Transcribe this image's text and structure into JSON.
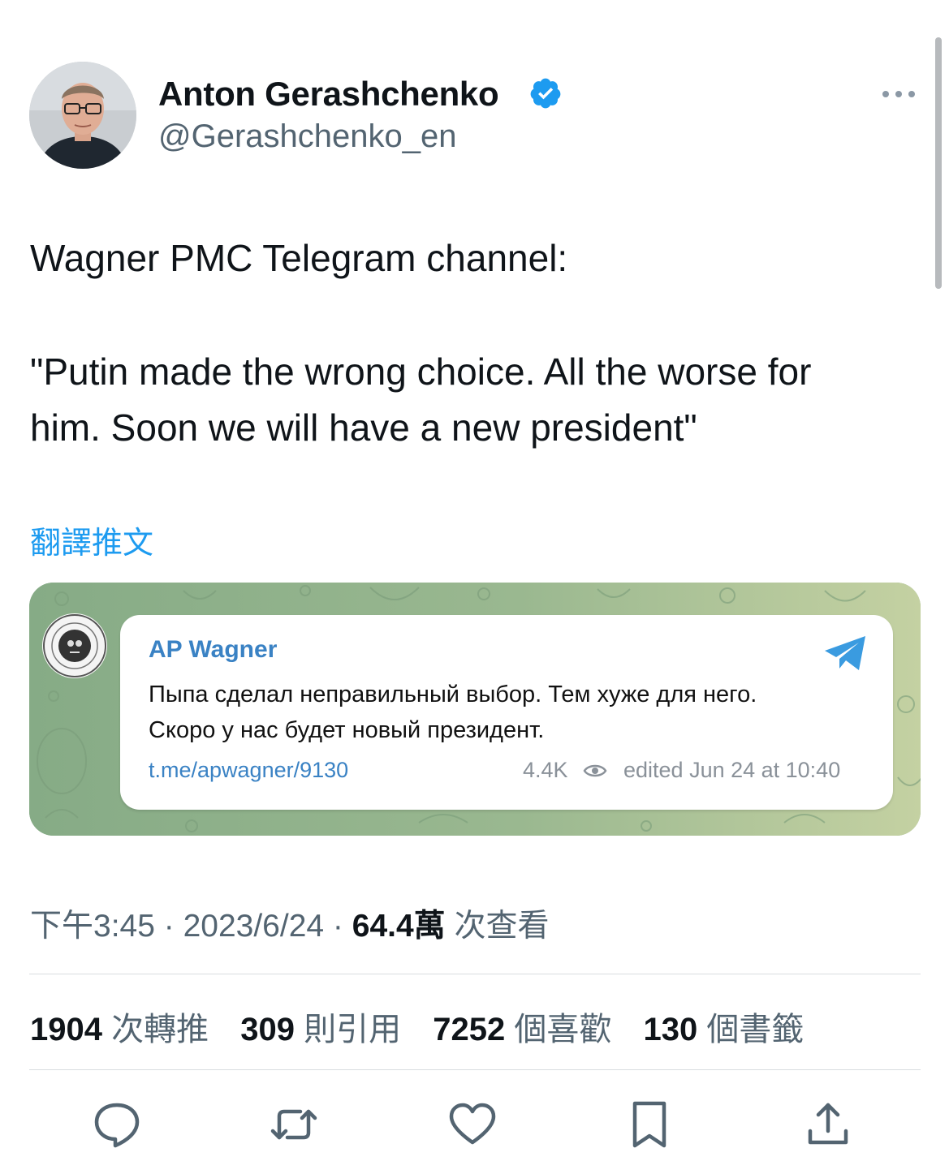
{
  "author": {
    "name": "Anton Gerashchenko",
    "handle": "@Gerashchenko_en",
    "verified_color": "#1d9bf0"
  },
  "tweet": {
    "lines": [
      "Wagner PMC Telegram channel:",
      "\"Putin made the wrong choice. All the worse for",
      "him. Soon we will have a new president\""
    ],
    "translate_label": "翻譯推文"
  },
  "telegram_card": {
    "channel": "AP Wagner",
    "message_lines": [
      "Пыпа сделал неправильный выбор. Тем хуже для него.",
      "Скоро у нас будет новый президент."
    ],
    "link": "t.me/apwagner/9130",
    "views": "4.4K",
    "edited": "edited  Jun 24 at 10:40"
  },
  "meta": {
    "time": "下午3:45",
    "sep1": " · ",
    "date": "2023/6/24",
    "sep2": " · ",
    "views_count": "64.4萬",
    "views_label": " 次查看"
  },
  "stats": {
    "retweets": "1904",
    "retweets_label": "次轉推",
    "quotes": "309",
    "quotes_label": "則引用",
    "likes": "7252",
    "likes_label": "個喜歡",
    "bookmarks": "130",
    "bookmarks_label": "個書籤"
  },
  "actions": [
    "reply-icon",
    "retweet-icon",
    "like-icon",
    "bookmark-icon",
    "share-icon"
  ],
  "colors": {
    "accent": "#1d9bf0",
    "secondary_text": "#536471",
    "telegram_blue": "#3a82c4",
    "telegram_bg": "#8fb28e"
  }
}
